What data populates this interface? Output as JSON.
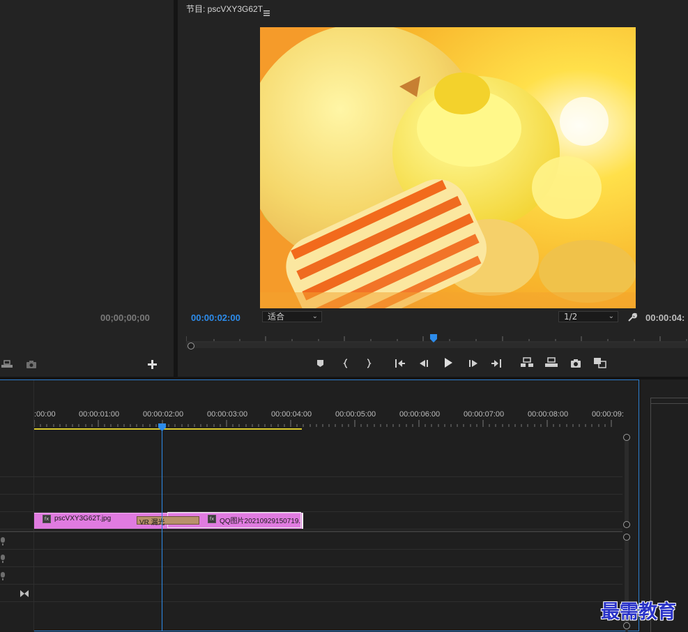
{
  "source_monitor": {
    "timecode": "00;00;00;00"
  },
  "program_monitor": {
    "title": "节目: pscVXY3G62T",
    "menu_icon": "hamburger-icon",
    "current_timecode": "00:00:02:00",
    "fit_select": "适合",
    "resolution_select": "1/2",
    "duration_timecode": "00:00:04:"
  },
  "transport": {
    "buttons": [
      "marker-icon",
      "mark-in-icon",
      "mark-out-icon",
      "go-to-in-icon",
      "step-back-icon",
      "play-icon",
      "step-forward-icon",
      "go-to-out-icon",
      "lift-icon",
      "extract-icon",
      "export-frame-icon",
      "compare-icon"
    ]
  },
  "timeline": {
    "ruler_labels": [
      ":00:00",
      "00:00:01:00",
      "00:00:02:00",
      "00:00:03:00",
      "00:00:04:00",
      "00:00:05:00",
      "00:00:06:00",
      "00:00:07:00",
      "00:00:08:00",
      "00:00:09:"
    ],
    "clip1_name": "pscVXY3G62T.jpg",
    "transition_name": "VR 漏光",
    "clip2_name": "QQ图片20210929150719."
  },
  "watermark": "最需教育",
  "colors": {
    "accent_blue": "#2d8ceb",
    "clip_pink": "#e07be0",
    "work_area_yellow": "#d9c92d",
    "transition_tan": "#b8916a"
  }
}
